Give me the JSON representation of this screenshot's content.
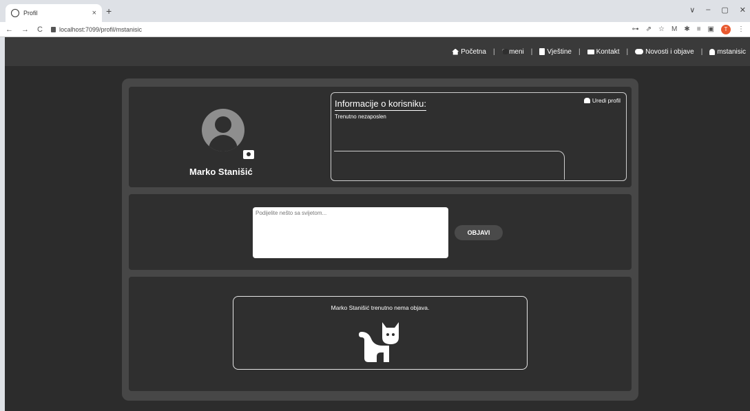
{
  "browser": {
    "tab_title": "Profil",
    "tab_close": "×",
    "new_tab": "+",
    "url": "localhost:7099/profil/mstanisic",
    "profile_initial": "T",
    "window_controls": [
      "∨",
      "–",
      "▢",
      "✕"
    ]
  },
  "navbar": {
    "items": [
      {
        "label": "Početna",
        "icon": "home-icon"
      },
      {
        "label": "O meni",
        "icon": "id-card-icon"
      },
      {
        "label": "Vještine",
        "icon": "book-icon"
      },
      {
        "label": "Kontakt",
        "icon": "envelope-icon"
      },
      {
        "label": "Novosti i objave",
        "icon": "comments-icon"
      },
      {
        "label": "mstanisic",
        "icon": "user-icon"
      }
    ],
    "separator": "|"
  },
  "profile": {
    "name": "Marko Stanišić",
    "info_title": "Informacije o korisniku:",
    "status": "Trenutno nezaposlen",
    "edit_label": "Uredi profil"
  },
  "post": {
    "placeholder": "Podijelite nešto sa svijetom...",
    "button_label": "OBJAVI"
  },
  "feed": {
    "empty_text": "Marko Stanišić trenutno nema objava."
  },
  "colors": {
    "page_bg": "#2c2c2c",
    "navbar_bg": "#3a3a3a",
    "panel_bg": "#474747",
    "card_bg": "#2f2f2f"
  }
}
